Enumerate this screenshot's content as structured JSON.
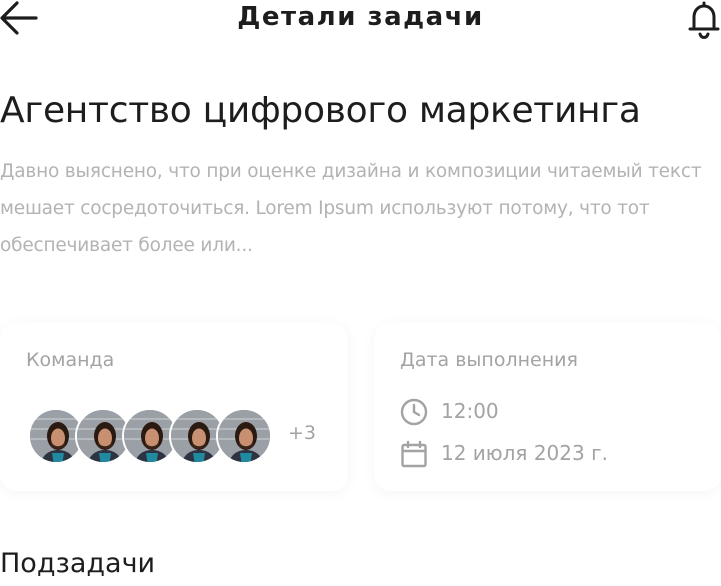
{
  "header": {
    "title": "Детали задачи",
    "back_icon": "arrow-left-icon",
    "bell_icon": "bell-icon"
  },
  "task": {
    "title": "Агентство цифрового маркетинга",
    "description": "Давно выяснено, что при оценке дизайна и композиции читаемый текст мешает сосредоточиться. Lorem Ipsum используют потому, что тот обеспечивает более или..."
  },
  "team": {
    "label": "Команда",
    "more": "+3",
    "avatar_count_shown": 5
  },
  "due": {
    "label": "Дата выполнения",
    "time": "12:00",
    "date": "12 июля 2023 г.",
    "time_icon": "clock-icon",
    "date_icon": "calendar-icon"
  },
  "subtasks": {
    "title": "Подзадачи"
  },
  "colors": {
    "text_primary": "#1d1d1d",
    "text_muted": "#a3a3a3",
    "description": "#b3b3b3",
    "background": "#ffffff"
  }
}
